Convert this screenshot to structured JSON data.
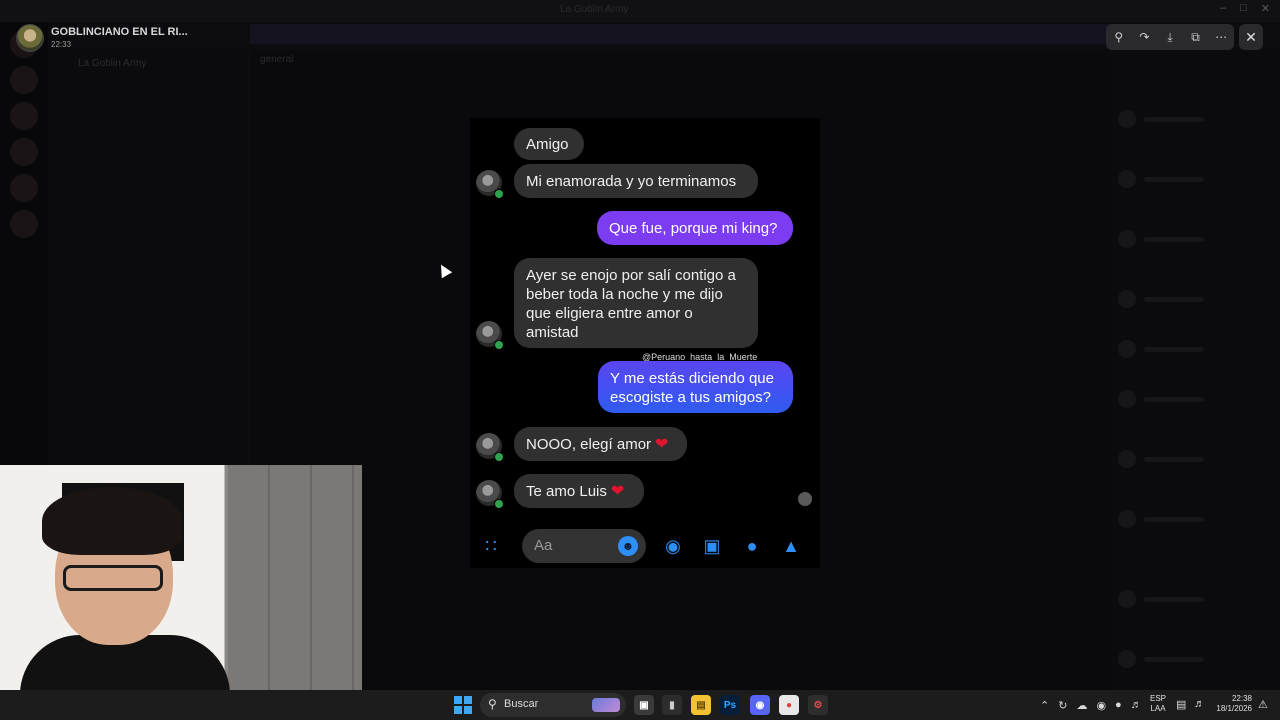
{
  "background_app": {
    "window_title": "La Goblin Army",
    "server_name": "La Goblin Army",
    "channel_header": "general"
  },
  "viewer": {
    "sender_name": "GOBLINCIANO EN EL RI...",
    "sender_time": "22:33",
    "toolbar_icons": [
      "zoom-icon",
      "share-icon",
      "download-icon",
      "open-external-icon",
      "more-icon"
    ],
    "close_icon": "close-icon"
  },
  "conversation": {
    "messages": [
      {
        "side": "received",
        "text": "Amigo",
        "heart": false
      },
      {
        "side": "received",
        "text": "Mi enamorada y yo terminamos",
        "heart": false
      },
      {
        "side": "sent",
        "text": "Que fue, porque mi king?",
        "heart": false
      },
      {
        "side": "received",
        "lines": [
          "Ayer se enojo por salí contigo a",
          "beber toda la noche y me dijo",
          "que eligiera entre amor o",
          "amistad"
        ],
        "heart": false
      },
      {
        "side": "sent",
        "lines": [
          "Y me estás diciendo que",
          "escogiste a tus amigos?"
        ],
        "heart": false
      },
      {
        "side": "received",
        "text": "NOOO, elegí  amor",
        "heart": true
      },
      {
        "side": "received",
        "text": "Te amo Luis",
        "heart": true
      }
    ],
    "watermark": "@Peruano_hasta_la_Muerte",
    "compose_placeholder": "Aa",
    "colors": {
      "received_bubble": "#303030",
      "sent_gradient_top": "#7b3cf2",
      "sent_gradient_bottom": "#2f5cf0",
      "accent_blue": "#2e8ff6",
      "heart": "#e0142e",
      "online": "#31a24c"
    }
  },
  "taskbar": {
    "search_label": "Buscar",
    "lang_line1": "ESP",
    "lang_line2": "LAA",
    "time": "22:38",
    "date": "18/1/2026"
  }
}
